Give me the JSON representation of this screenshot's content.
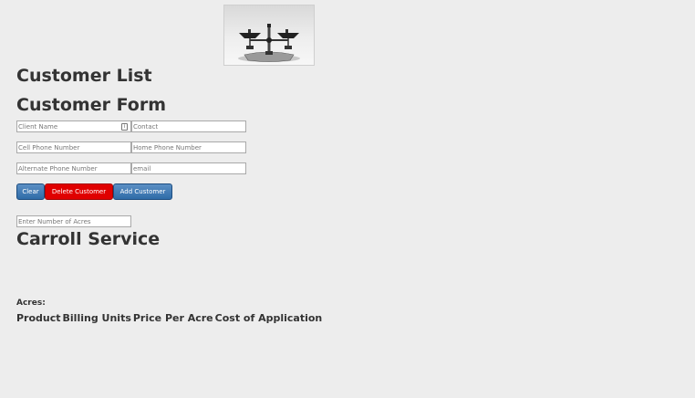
{
  "logo": {
    "icon": "balance-scale-icon"
  },
  "headings": {
    "customer_list": "Customer List",
    "customer_form": "Customer Form",
    "service": "Carroll Service"
  },
  "form": {
    "client_name_placeholder": "Client Name",
    "contact_placeholder": "Contact",
    "cell_phone_placeholder": "Cell Phone Number",
    "home_phone_placeholder": "Home Phone Number",
    "alternate_phone_placeholder": "Alternate Phone Number",
    "email_placeholder": "email",
    "acres_placeholder": "Enter Number of Acres"
  },
  "buttons": {
    "clear": "Clear",
    "delete_customer": "Delete Customer",
    "add_customer": "Add Customer"
  },
  "acres_label": "Acres:",
  "table": {
    "columns": [
      "Product",
      "Billing Units",
      "Price Per Acre",
      "Cost of Application"
    ]
  },
  "colors": {
    "background": "#ededed",
    "primary_button": "#2f6ca8",
    "danger_button": "#e00000"
  }
}
